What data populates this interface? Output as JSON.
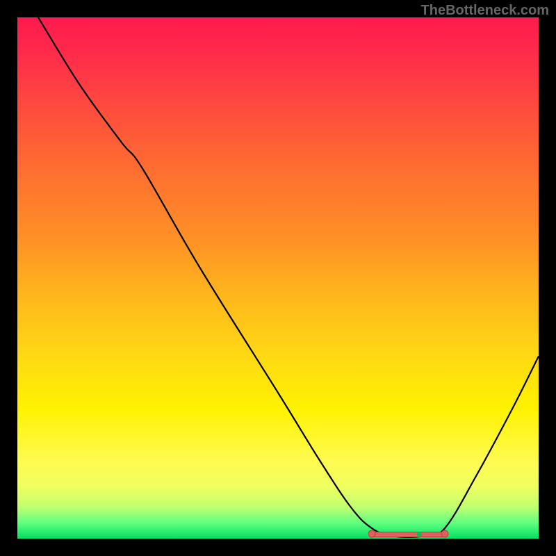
{
  "watermark": "TheBottleneck.com",
  "chart_data": {
    "type": "line",
    "title": "",
    "xlabel": "",
    "ylabel": "",
    "x_range": [
      0,
      100
    ],
    "y_range": [
      0,
      100
    ],
    "series": [
      {
        "name": "bottleneck-curve",
        "points": [
          {
            "x": 4,
            "y": 100
          },
          {
            "x": 12,
            "y": 87
          },
          {
            "x": 20,
            "y": 76
          },
          {
            "x": 24,
            "y": 71
          },
          {
            "x": 35,
            "y": 52
          },
          {
            "x": 50,
            "y": 28
          },
          {
            "x": 58,
            "y": 15
          },
          {
            "x": 64,
            "y": 6
          },
          {
            "x": 68,
            "y": 2
          },
          {
            "x": 72,
            "y": 0.5
          },
          {
            "x": 78,
            "y": 0.5
          },
          {
            "x": 82,
            "y": 2
          },
          {
            "x": 88,
            "y": 12
          },
          {
            "x": 95,
            "y": 25
          },
          {
            "x": 100,
            "y": 35
          }
        ]
      }
    ],
    "optimal_range": {
      "start": 68,
      "end": 82
    },
    "markers": [
      {
        "x": 68,
        "y": 1
      },
      {
        "x": 82,
        "y": 1
      }
    ]
  },
  "colors": {
    "curve": "#000000",
    "marker": "#e06060",
    "background_top": "#ff1a4d",
    "background_bottom": "#00e060"
  }
}
